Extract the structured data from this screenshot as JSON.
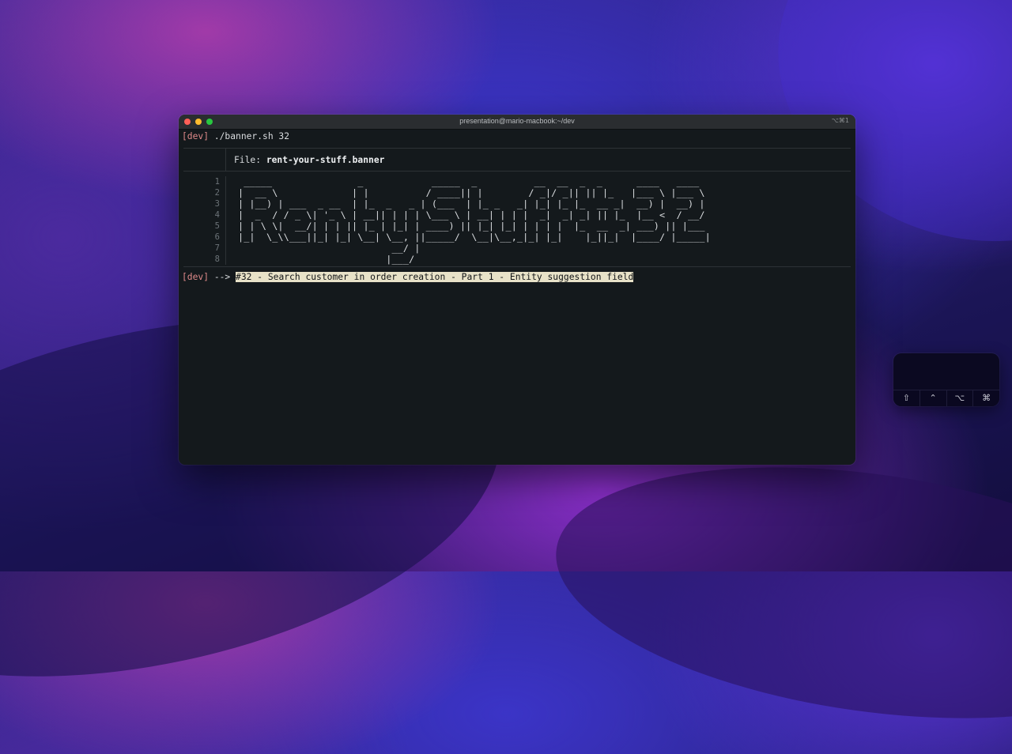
{
  "window": {
    "title": "presentation@mario-macbook:~/dev",
    "shortcut": "⌥⌘1"
  },
  "terminal": {
    "prompt_tag": "[dev]",
    "command": " ./banner.sh 32",
    "file_label": "File: ",
    "file_name": "rent-your-stuff.banner",
    "line_numbers": [
      "1",
      "2",
      "3",
      "4",
      "5",
      "6",
      "7",
      "8"
    ],
    "banner_lines": [
      " _____               _            _____  _          __  __  _  _      ____   ____ ",
      "|  __ \\             | |          / ____|| |        / _|/ _|| || |_   |___ \\ |___ \\",
      "| |__) | ___  _ __  | |_  _   _ | (___  | |_ _   _| |_| |_ |_  __ _|  __) |  __) |",
      "|  _  / / _ \\| '_ \\ | __|| | | | \\___ \\ | __| | | |  _|  _| _| || |_  |__ <  / __/",
      "| | \\ \\|  __/| | | || |_ | |_| | ____) || |_| |_| | | | |  |_  __  _| ___) || |___",
      "|_|  \\_\\\\___||_| |_| \\__| \\__, ||_____/  \\__|\\__,_|_| |_|    |_||_|  |____/ |_____|",
      "                           __/ |",
      "                          |___/"
    ],
    "result_arrow": " --> ",
    "result_text": "#32 - Search customer in order creation - Part 1 - Entity suggestion field"
  },
  "touchbar": {
    "keys": [
      {
        "icon": "shift-icon",
        "glyph": "⇧"
      },
      {
        "icon": "control-icon",
        "glyph": "⌃"
      },
      {
        "icon": "option-icon",
        "glyph": "⌥"
      },
      {
        "icon": "command-icon",
        "glyph": "⌘"
      }
    ]
  }
}
